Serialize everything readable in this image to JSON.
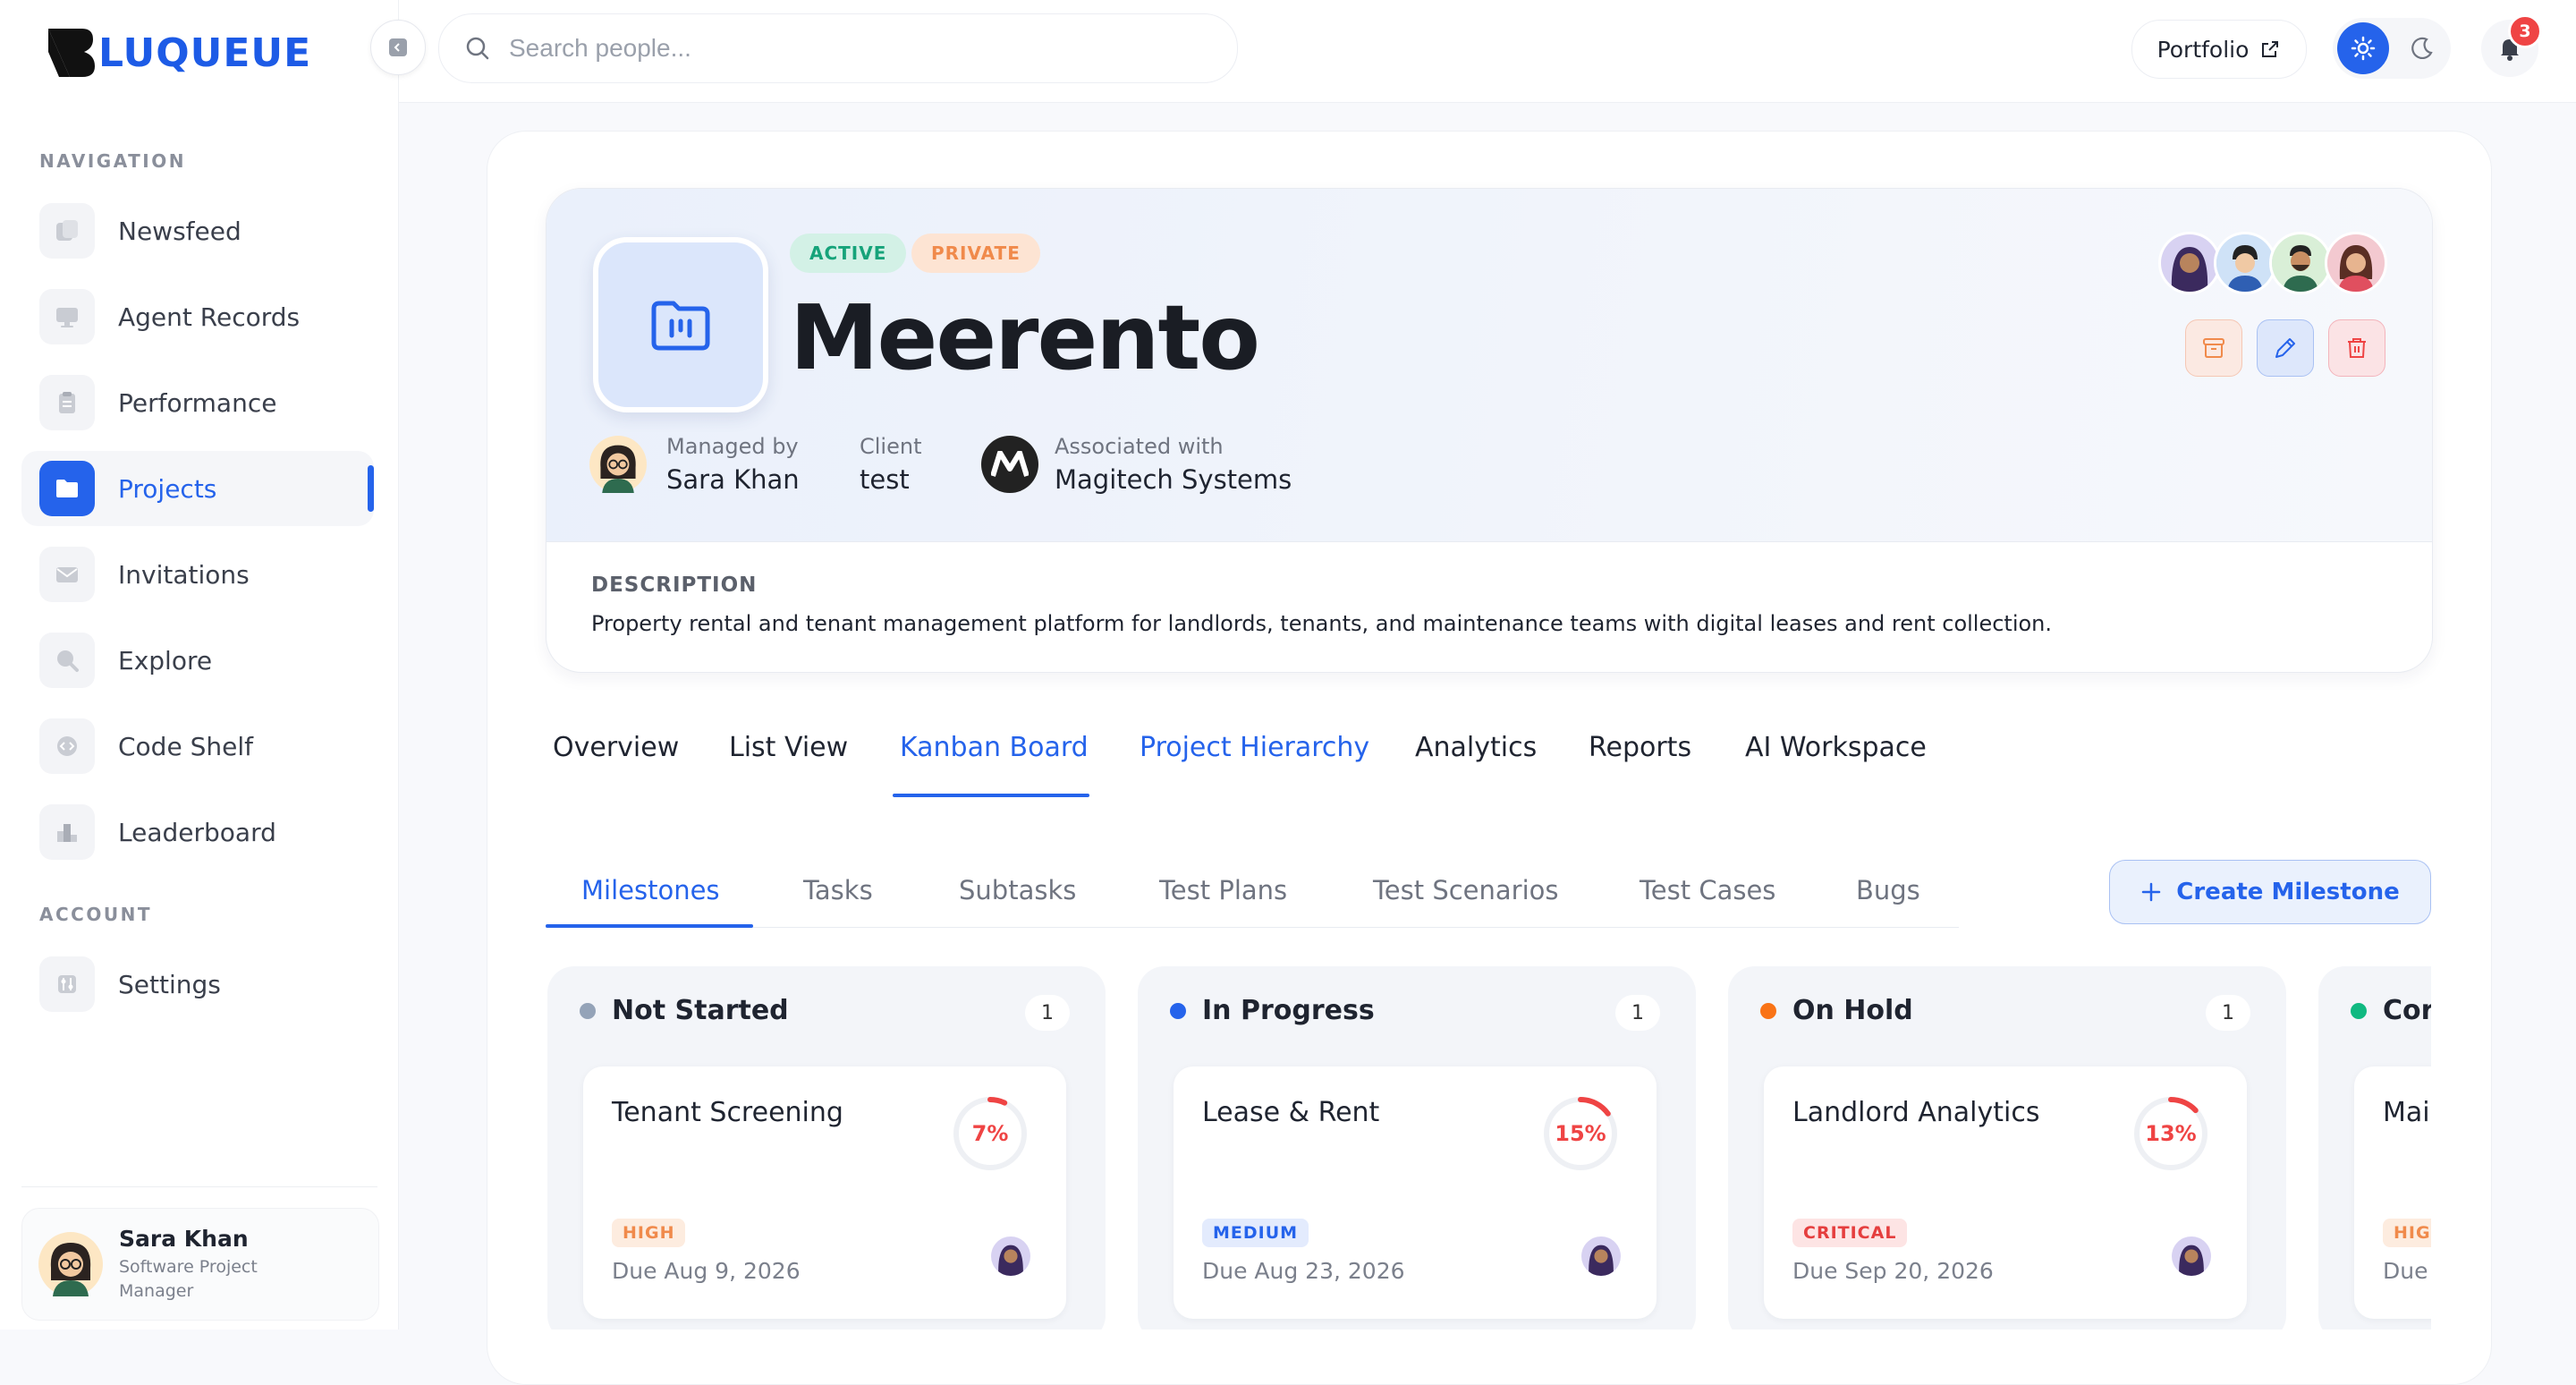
{
  "brand": {
    "logo_letter": "B",
    "logo_rest": "LUQUEUE"
  },
  "sidebar": {
    "nav_section": "NAVIGATION",
    "account_section": "ACCOUNT",
    "items": [
      {
        "label": "Newsfeed",
        "icon": "newsfeed-icon"
      },
      {
        "label": "Agent Records",
        "icon": "monitor-icon"
      },
      {
        "label": "Performance",
        "icon": "clipboard-icon"
      },
      {
        "label": "Projects",
        "icon": "folder-icon",
        "active": true
      },
      {
        "label": "Invitations",
        "icon": "envelope-icon"
      },
      {
        "label": "Explore",
        "icon": "search-icon"
      },
      {
        "label": "Code Shelf",
        "icon": "code-icon"
      },
      {
        "label": "Leaderboard",
        "icon": "podium-icon"
      }
    ],
    "account_items": [
      {
        "label": "Settings",
        "icon": "sliders-icon"
      }
    ],
    "user": {
      "name": "Sara Khan",
      "role": "Software Project Manager"
    }
  },
  "topbar": {
    "search_placeholder": "Search people...",
    "portfolio_label": "Portfolio",
    "notification_count": "3"
  },
  "project": {
    "status": "ACTIVE",
    "visibility": "PRIVATE",
    "name": "Meerento",
    "managed_by_label": "Managed by",
    "manager": "Sara Khan",
    "client_label": "Client",
    "client": "test",
    "associated_label": "Associated with",
    "associated": "Magitech Systems",
    "description_label": "DESCRIPTION",
    "description": "Property rental and tenant management platform for landlords, tenants, and maintenance teams with digital leases and rent collection."
  },
  "tabs": [
    "Overview",
    "List View",
    "Kanban Board",
    "Project Hierarchy",
    "Analytics",
    "Reports",
    "AI Workspace"
  ],
  "active_tab": "Kanban Board",
  "subtabs": [
    "Milestones",
    "Tasks",
    "Subtasks",
    "Test Plans",
    "Test Scenarios",
    "Test Cases",
    "Bugs"
  ],
  "active_subtab": "Milestones",
  "create_label": "Create Milestone",
  "columns": [
    {
      "title": "Not Started",
      "count": "1",
      "color": "#94a3b8",
      "card": {
        "title": "Tenant Screening",
        "progress": 7,
        "progress_label": "7%",
        "priority": "HIGH",
        "due": "Due Aug 9, 2026"
      }
    },
    {
      "title": "In Progress",
      "count": "1",
      "color": "#2563eb",
      "card": {
        "title": "Lease & Rent",
        "progress": 15,
        "progress_label": "15%",
        "priority": "MEDIUM",
        "due": "Due Aug 23, 2026"
      }
    },
    {
      "title": "On Hold",
      "count": "1",
      "color": "#f97316",
      "card": {
        "title": "Landlord Analytics",
        "progress": 13,
        "progress_label": "13%",
        "priority": "CRITICAL",
        "due": "Due Sep 20, 2026"
      }
    },
    {
      "title": "Cor",
      "count": "",
      "color": "#10b981",
      "card": {
        "title": "Mai",
        "priority": "HIG",
        "due": "Due"
      }
    }
  ],
  "colors": {
    "accent": "#2563eb",
    "active_badge": "#16a37a",
    "private_badge": "#f08a4b",
    "danger": "#ef4444"
  }
}
